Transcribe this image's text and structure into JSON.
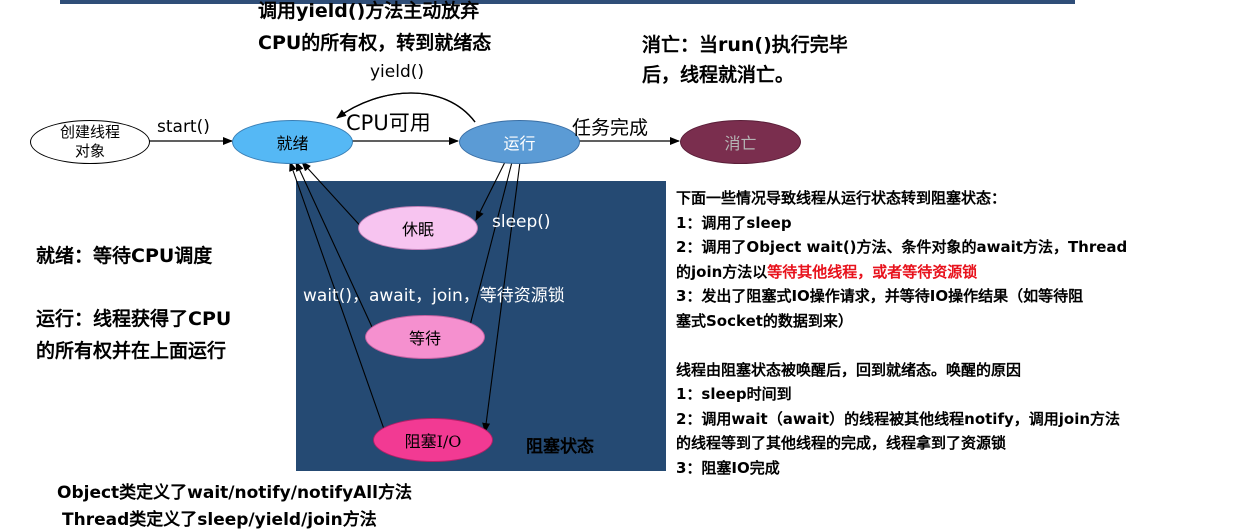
{
  "top_note": {
    "yield_line1": "调用yield()方法主动放弃",
    "yield_line2": "CPU的所有权，转到就绪态",
    "death_line1": "消亡：当run()执行完毕",
    "death_line2": "后，线程就消亡。"
  },
  "nodes": {
    "create_line1": "创建线程",
    "create_line2": "对象",
    "ready": "就绪",
    "running": "运行",
    "dead": "消亡",
    "sleep": "休眠",
    "wait": "等待",
    "blocked_io": "阻塞I/O"
  },
  "edge_labels": {
    "start": "start()",
    "yield": "yield()",
    "cpu_available": "CPU可用",
    "task_done": "任务完成",
    "sleep": "sleep()",
    "wait_group": "wait()，await，join，等待资源锁",
    "blocked_state": "阻塞状态"
  },
  "left_notes": {
    "ready_note": "就绪：等待CPU调度",
    "running_line1": "运行：线程获得了CPU",
    "running_line2": "的所有权并在上面运行"
  },
  "bottom_notes": {
    "object_line": "Object类定义了wait/notify/notifyAll方法",
    "thread_line": "Thread类定义了sleep/yield/join方法"
  },
  "right_panel": {
    "heading": "下面一些情况导致线程从运行状态转到阻塞状态：",
    "item1": "1：调用了sleep",
    "item2_line1": "2：调用了Object wait()方法、条件对象的await方法，Thread",
    "item2_line2_prefix": "的join方法以",
    "item2_line2_red": "等待其他线程，或者等待资源锁",
    "item3_line1": "3：发出了阻塞式IO操作请求，并等待IO操作结果（如等待阻",
    "item3_line2": "塞式Socket的数据到来）",
    "wake_heading": "线程由阻塞状态被唤醒后，回到就绪态。唤醒的原因",
    "wake1": "1：sleep时间到",
    "wake2_line1": "2：调用wait（await）的线程被其他线程notify，调用join方法",
    "wake2_line2": "的线程等到了其他线程的完成，线程拿到了资源锁",
    "wake3": "3：阻塞IO完成"
  },
  "colors": {
    "ready": "#55b8f5",
    "running": "#5b9bd5",
    "dead": "#7a2e4e",
    "sleep": "#f7c4f0",
    "wait": "#f590cf",
    "blocked_io": "#f23a93",
    "blocked_box": "#254a73",
    "highlight_red": "#e8121c"
  }
}
